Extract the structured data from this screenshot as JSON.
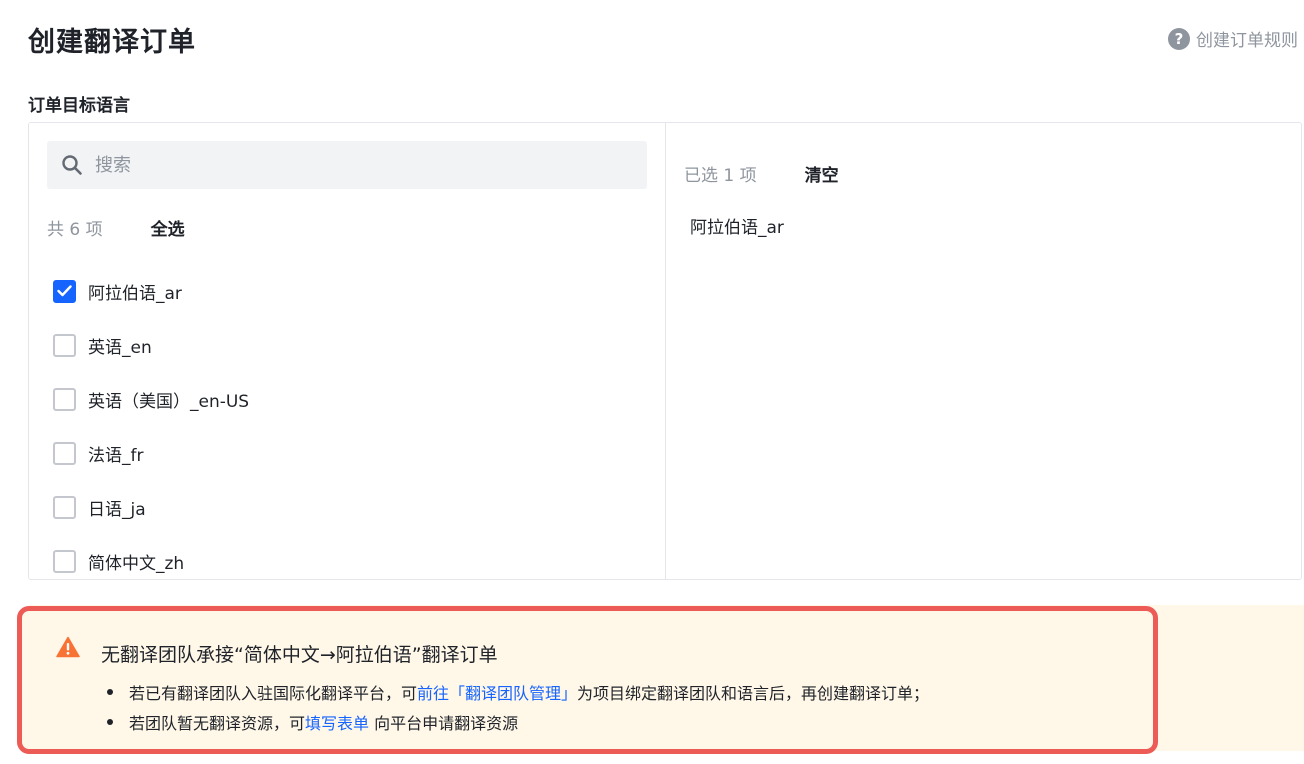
{
  "header": {
    "title": "创建翻译订单",
    "rules_link": "创建订单规则"
  },
  "section_label": "订单目标语言",
  "left_panel": {
    "search_placeholder": "搜索",
    "count_text": "共 6 项",
    "select_all": "全选",
    "options": [
      {
        "label": "阿拉伯语_ar",
        "checked": true
      },
      {
        "label": "英语_en",
        "checked": false
      },
      {
        "label": "英语（美国）_en-US",
        "checked": false
      },
      {
        "label": "法语_fr",
        "checked": false
      },
      {
        "label": "日语_ja",
        "checked": false
      },
      {
        "label": "简体中文_zh",
        "checked": false
      }
    ]
  },
  "right_panel": {
    "count_text": "已选 1 项",
    "clear": "清空",
    "selected": [
      "阿拉伯语_ar"
    ]
  },
  "alert": {
    "title": "无翻译团队承接“简体中文→阿拉伯语”翻译订单",
    "line1_prefix": "若已有翻译团队入驻国际化翻译平台，可",
    "line1_link": "前往「翻译团队管理」",
    "line1_suffix": "为项目绑定翻译团队和语言后，再创建翻译订单；",
    "line2_prefix": "若团队暂无翻译资源，可",
    "line2_link": "填写表单",
    "line2_suffix": " 向平台申请翻译资源"
  },
  "colors": {
    "accent": "#1664ff",
    "warning": "#f77234",
    "alert_bg": "#fff7e8",
    "highlight_border": "#ec5b56"
  }
}
